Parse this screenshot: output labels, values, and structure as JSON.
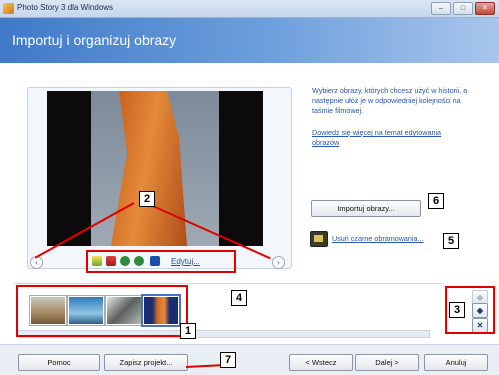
{
  "window": {
    "title": "Photo Story 3 dla Windows",
    "minimize": "–",
    "maximize": "□",
    "close": "✕"
  },
  "header": {
    "title": "Importuj i organizuj obrazy"
  },
  "info": {
    "text": "Wybierz obrazy, których chcesz użyć w historii, a następnie ułóż je w odpowiedniej kolejności na taśmie filmowej.",
    "link": "Dowiedz się więcej na temat edytowania obrazów"
  },
  "viewer": {
    "prev_arrow": "‹",
    "next_arrow": "›",
    "edit_label": "Edytuj..."
  },
  "buttons": {
    "import": "Importuj obrazy...",
    "remove_black": "Usuń czarne obramowania...",
    "help": "Pomoc",
    "save_project": "Zapisz projekt...",
    "back": "< Wstecz",
    "next": "Dalej >",
    "cancel": "Anuluj"
  },
  "side": {
    "up": "◆",
    "left": "◆",
    "delete": "✕"
  },
  "callouts": [
    "1",
    "2",
    "3",
    "4",
    "5",
    "6",
    "7"
  ],
  "colors": {
    "header": "#3f79c8",
    "link": "#2a56b0",
    "annotation": "#e00000"
  }
}
